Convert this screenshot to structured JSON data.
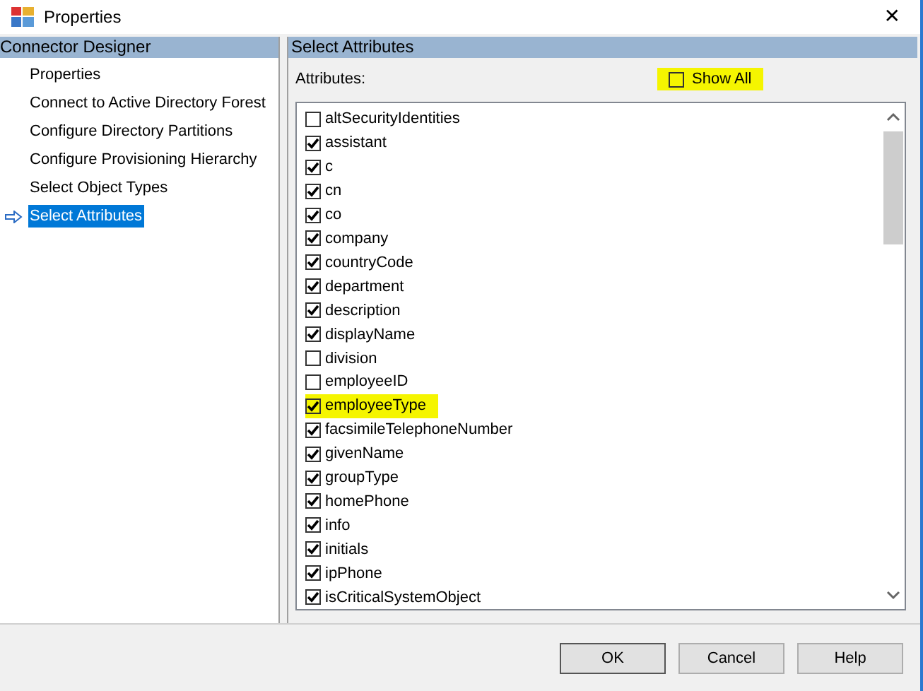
{
  "window": {
    "title": "Properties",
    "close": "✕"
  },
  "sidebar": {
    "title": "Connector Designer",
    "items": [
      {
        "label": "Properties",
        "selected": false
      },
      {
        "label": "Connect to Active Directory Forest",
        "selected": false
      },
      {
        "label": "Configure Directory Partitions",
        "selected": false
      },
      {
        "label": "Configure Provisioning Hierarchy",
        "selected": false
      },
      {
        "label": "Select Object Types",
        "selected": false
      },
      {
        "label": "Select Attributes",
        "selected": true
      }
    ]
  },
  "panel": {
    "title": "Select Attributes",
    "attributes_label": "Attributes:",
    "show_all": {
      "label": "Show All",
      "checked": false,
      "highlighted": true
    },
    "attributes": [
      {
        "name": "altSecurityIdentities",
        "checked": false,
        "highlighted": false
      },
      {
        "name": "assistant",
        "checked": true,
        "highlighted": false
      },
      {
        "name": "c",
        "checked": true,
        "highlighted": false
      },
      {
        "name": "cn",
        "checked": true,
        "highlighted": false
      },
      {
        "name": "co",
        "checked": true,
        "highlighted": false
      },
      {
        "name": "company",
        "checked": true,
        "highlighted": false
      },
      {
        "name": "countryCode",
        "checked": true,
        "highlighted": false
      },
      {
        "name": "department",
        "checked": true,
        "highlighted": false
      },
      {
        "name": "description",
        "checked": true,
        "highlighted": false
      },
      {
        "name": "displayName",
        "checked": true,
        "highlighted": false
      },
      {
        "name": "division",
        "checked": false,
        "highlighted": false
      },
      {
        "name": "employeeID",
        "checked": false,
        "highlighted": false
      },
      {
        "name": "employeeType",
        "checked": true,
        "highlighted": true
      },
      {
        "name": "facsimileTelephoneNumber",
        "checked": true,
        "highlighted": false
      },
      {
        "name": "givenName",
        "checked": true,
        "highlighted": false
      },
      {
        "name": "groupType",
        "checked": true,
        "highlighted": false
      },
      {
        "name": "homePhone",
        "checked": true,
        "highlighted": false
      },
      {
        "name": "info",
        "checked": true,
        "highlighted": false
      },
      {
        "name": "initials",
        "checked": true,
        "highlighted": false
      },
      {
        "name": "ipPhone",
        "checked": true,
        "highlighted": false
      },
      {
        "name": "isCriticalSystemObject",
        "checked": true,
        "highlighted": false
      }
    ]
  },
  "buttons": [
    "OK",
    "Cancel",
    "Help"
  ]
}
